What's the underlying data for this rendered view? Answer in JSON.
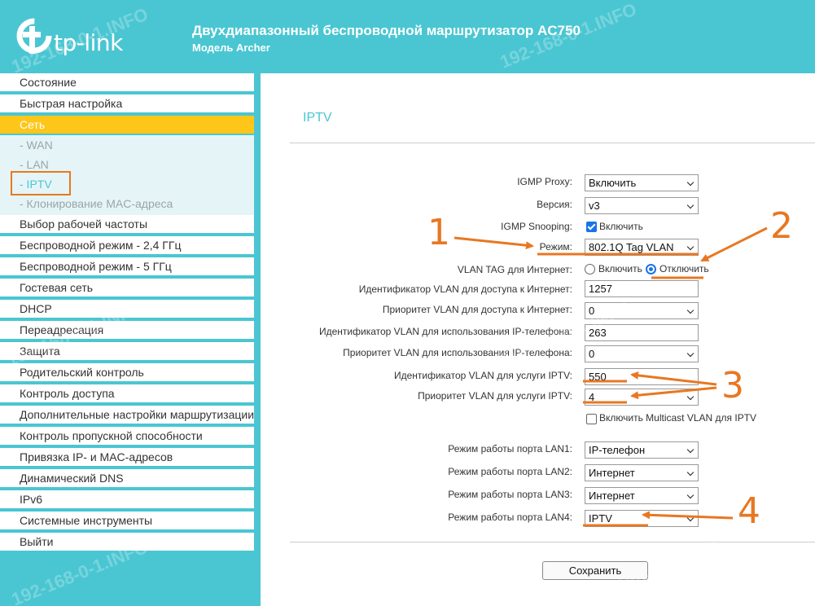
{
  "header": {
    "logo_text": "tp-link",
    "title": "Двухдиапазонный беспроводной маршрутизатор AC750",
    "model": "Модель Archer"
  },
  "sidebar": {
    "items_top": [
      {
        "label": "Состояние"
      },
      {
        "label": "Быстрая настройка"
      },
      {
        "label": "Сеть",
        "active": true
      }
    ],
    "sub_items": [
      {
        "label": "- WAN"
      },
      {
        "label": "- LAN"
      },
      {
        "label": "- IPTV",
        "current": true
      },
      {
        "label": "- Клонирование MAC-адреса"
      }
    ],
    "items_bottom": [
      {
        "label": "Выбор рабочей частоты"
      },
      {
        "label": "Беспроводной режим - 2,4 ГГц"
      },
      {
        "label": "Беспроводной режим - 5 ГГц"
      },
      {
        "label": "Гостевая сеть"
      },
      {
        "label": "DHCP"
      },
      {
        "label": "Переадресация"
      },
      {
        "label": "Защита"
      },
      {
        "label": "Родительский контроль"
      },
      {
        "label": "Контроль доступа"
      },
      {
        "label": "Дополнительные настройки маршрутизации"
      },
      {
        "label": "Контроль пропускной способности"
      },
      {
        "label": "Привязка IP- и MAC-адресов"
      },
      {
        "label": "Динамический DNS"
      },
      {
        "label": "IPv6"
      },
      {
        "label": "Системные инструменты"
      },
      {
        "label": "Выйти"
      }
    ]
  },
  "main": {
    "title": "IPTV",
    "igmp_proxy": {
      "label": "IGMP Proxy:",
      "value": "Включить"
    },
    "version": {
      "label": "Версия:",
      "value": "v3"
    },
    "igmp_snooping": {
      "label": "IGMP Snooping:",
      "checkbox_label": "Включить",
      "checked": true
    },
    "mode": {
      "label": "Режим:",
      "value": "802.1Q Tag VLAN"
    },
    "vlan_tag": {
      "label": "VLAN TAG для Интернет:",
      "option_on": "Включить",
      "option_off": "Отключить",
      "selected": "Отключить"
    },
    "internet_vlan_id": {
      "label": "Идентификатор VLAN для доступа к Интернет:",
      "value": "1257"
    },
    "internet_vlan_priority": {
      "label": "Приоритет VLAN для доступа к Интернет:",
      "value": "0"
    },
    "phone_vlan_id": {
      "label": "Идентификатор VLAN для использования IP-телефона:",
      "value": "263"
    },
    "phone_vlan_priority": {
      "label": "Приоритет VLAN для использования IP-телефона:",
      "value": "0"
    },
    "iptv_vlan_id": {
      "label": "Идентификатор VLAN для услуги IPTV:",
      "value": "550"
    },
    "iptv_vlan_priority": {
      "label": "Приоритет VLAN для услуги IPTV:",
      "value": "4"
    },
    "multicast_vlan": {
      "checkbox_label": "Включить Multicast VLAN для IPTV",
      "checked": false
    },
    "lan1": {
      "label": "Режим работы порта LAN1:",
      "value": "IP-телефон"
    },
    "lan2": {
      "label": "Режим работы порта LAN2:",
      "value": "Интернет"
    },
    "lan3": {
      "label": "Режим работы порта LAN3:",
      "value": "Интернет"
    },
    "lan4": {
      "label": "Режим работы порта LAN4:",
      "value": "IPTV"
    },
    "save_label": "Сохранить"
  },
  "annotations": [
    "1",
    "2",
    "3",
    "4"
  ],
  "watermark": "192-168-0-1.INFO",
  "colors": {
    "brand": "#4ac6d2",
    "active": "#ffc61a",
    "annotation": "#e87722",
    "radio": "#1a73e8"
  }
}
